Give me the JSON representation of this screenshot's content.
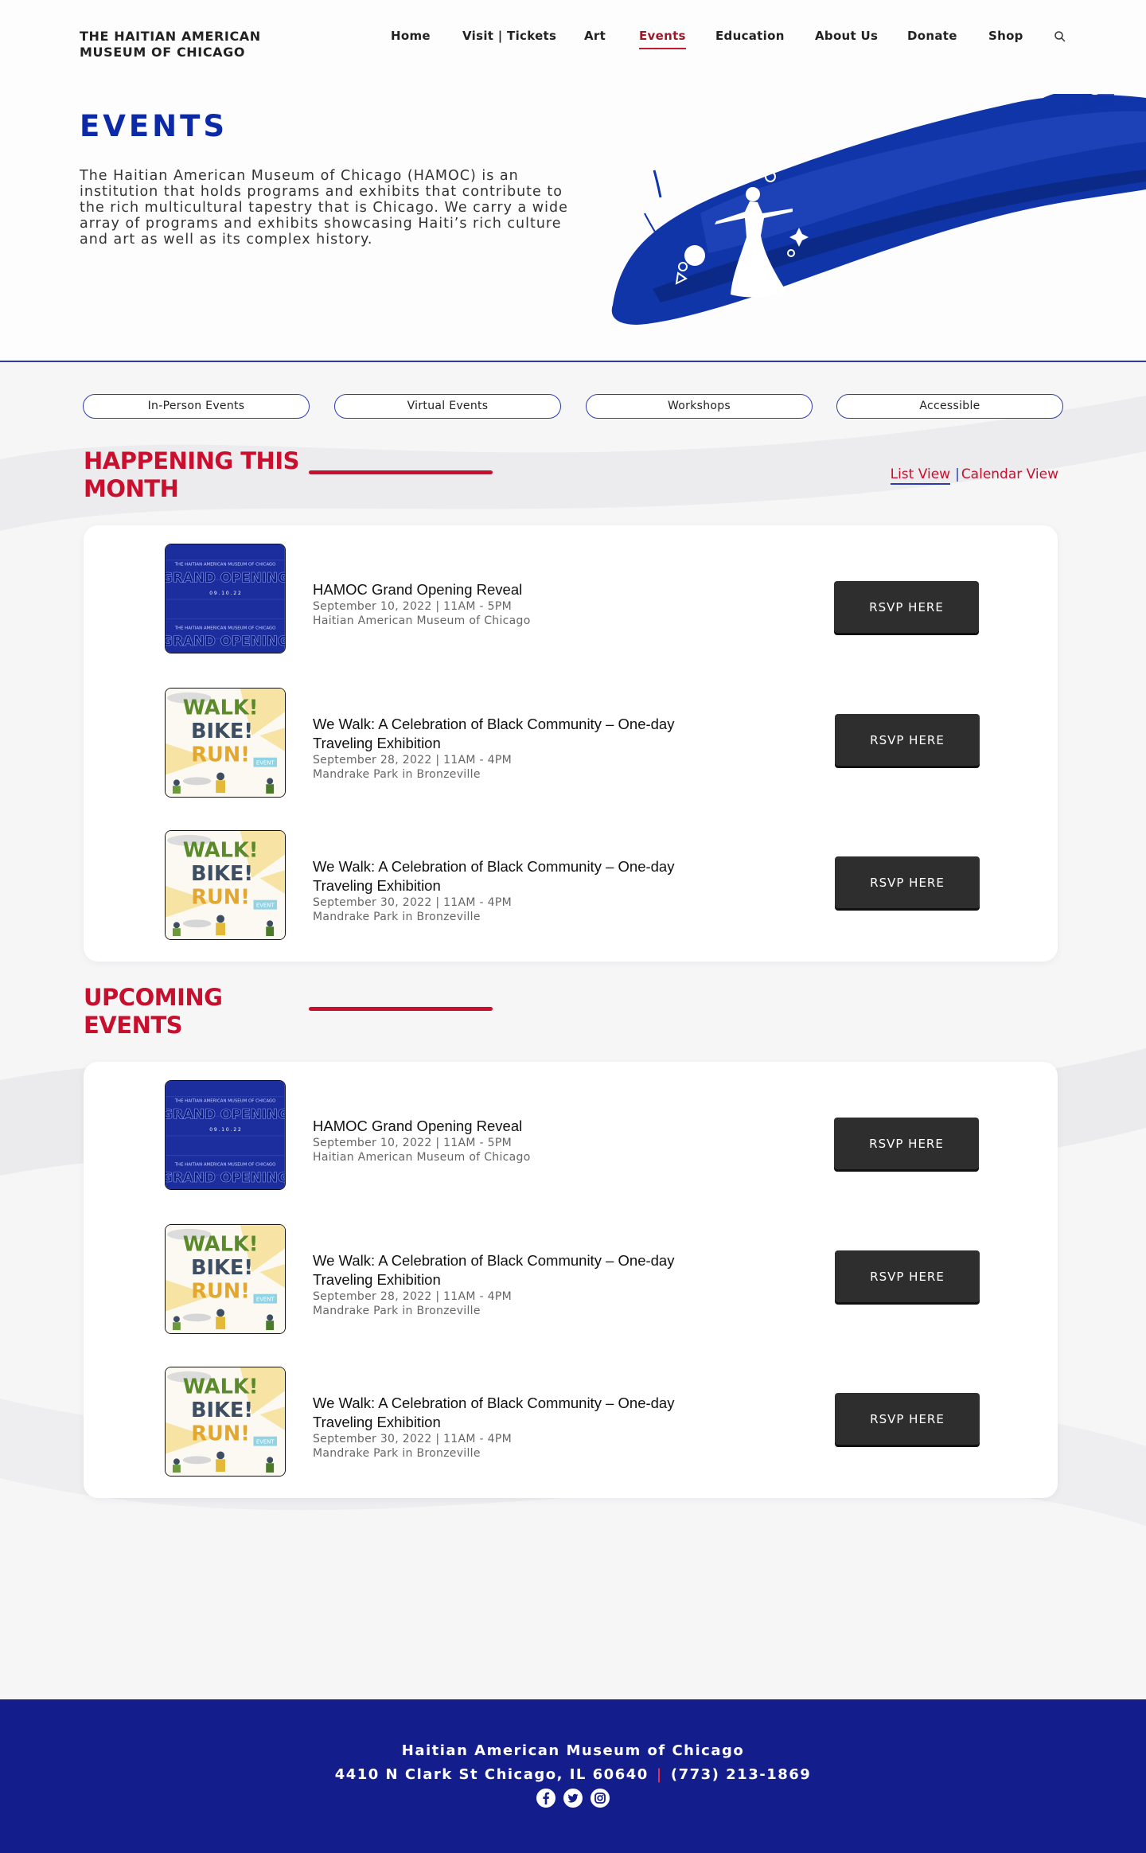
{
  "header": {
    "brand": "THE HAITIAN AMERICAN MUSEUM OF CHICAGO",
    "nav": [
      {
        "label": "Home"
      },
      {
        "label": "Visit | Tickets"
      },
      {
        "label": "Art"
      },
      {
        "label": "Events",
        "active": true
      },
      {
        "label": "Education"
      },
      {
        "label": "About Us"
      },
      {
        "label": "Donate"
      },
      {
        "label": "Shop"
      }
    ],
    "search_icon": "search-icon"
  },
  "hero": {
    "title": "EVENTS",
    "intro": "The Haitian American Museum of Chicago (HAMOC) is an institution that holds programs and exhibits that contribute to the rich multicultural tapestry that is Chicago. We carry a wide array of programs and exhibits showcasing Haiti’s rich culture and art as well as its complex history."
  },
  "filters": [
    "In-Person Events",
    "Virtual Events",
    "Workshops",
    "Accessible"
  ],
  "views": {
    "list": "List View",
    "separator": "|",
    "calendar": "Calendar View"
  },
  "sections": [
    {
      "title": "HAPPENING THIS MONTH",
      "events": [
        {
          "title": "HAMOC Grand Opening Reveal",
          "date": "September 10, 2022  |  11AM - 5PM",
          "location": "Haitian American Museum of Chicago",
          "image": "grand-opening",
          "rsvp": "RSVP  HERE"
        },
        {
          "title": "We Walk: A Celebration of Black Community – One-day Traveling Exhibition",
          "date": "September 28, 2022  |  11AM - 4PM",
          "location": "Mandrake Park in Bronzeville",
          "image": "walk-bike-run",
          "rsvp": "RSVP  HERE"
        },
        {
          "title": "We Walk: A Celebration of Black Community – One-day Traveling Exhibition",
          "date": "September 30, 2022  |  11AM - 4PM",
          "location": "Mandrake Park in Bronzeville",
          "image": "walk-bike-run",
          "rsvp": "RSVP  HERE"
        }
      ]
    },
    {
      "title": "UPCOMING EVENTS",
      "events": [
        {
          "title": "HAMOC Grand Opening Reveal",
          "date": "September 10, 2022  |  11AM - 5PM",
          "location": "Haitian American Museum of Chicago",
          "image": "grand-opening",
          "rsvp": "RSVP  HERE"
        },
        {
          "title": "We Walk: A Celebration of Black Community – One-day Traveling Exhibition",
          "date": "September 28, 2022  |  11AM - 4PM",
          "location": "Mandrake Park in Bronzeville",
          "image": "walk-bike-run",
          "rsvp": "RSVP  HERE"
        },
        {
          "title": "We Walk: A Celebration of Black Community – One-day Traveling Exhibition",
          "date": "September 30, 2022  |  11AM - 4PM",
          "location": "Mandrake Park in Bronzeville",
          "image": "walk-bike-run",
          "rsvp": "RSVP  HERE"
        }
      ]
    }
  ],
  "thumbs": {
    "grand_opening": {
      "small": "THE HAITIAN AMERICAN MUSEUM OF CHICAGO",
      "big": "GRAND OPENING",
      "date": "0 9 . 1 0 . 2 2"
    },
    "walk": {
      "w1": "WALK!",
      "w2": "BIKE!",
      "w3": "RUN!",
      "tag": "EVENT"
    }
  },
  "footer": {
    "name": "Haitian American Museum of Chicago",
    "address": "4410 N Clark St  Chicago, IL 60640",
    "phone": "(773) 213-1869",
    "socials": [
      "facebook-icon",
      "twitter-icon",
      "instagram-icon"
    ]
  },
  "colors": {
    "brand_blue": "#0c2aa6",
    "accent_red": "#c8102e",
    "footer_blue": "#131e8c",
    "button_dark": "#2e2e2e"
  }
}
